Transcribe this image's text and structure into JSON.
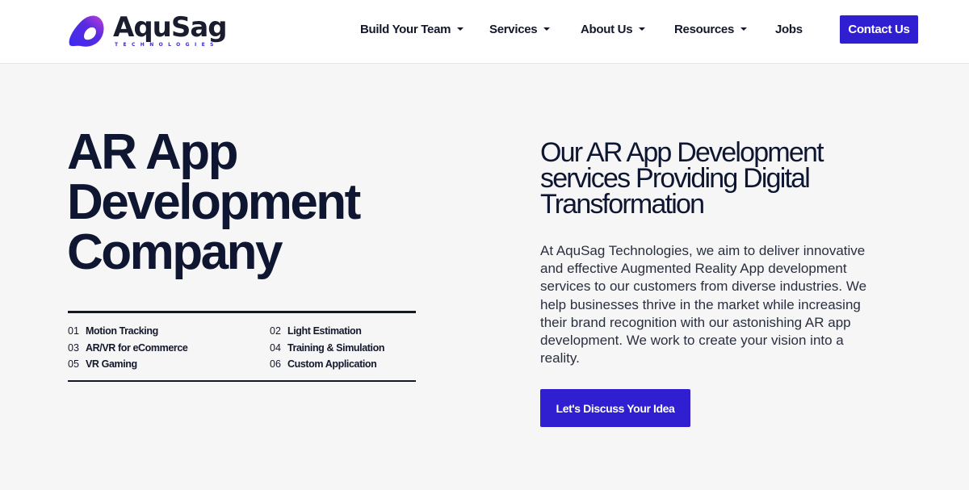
{
  "header": {
    "logo": {
      "name": "AquSag",
      "tagline": "TECHNOLOGIES"
    },
    "nav": [
      {
        "label": "Build Your Team",
        "has_dropdown": true
      },
      {
        "label": "Services",
        "has_dropdown": true
      },
      {
        "label": "About Us",
        "has_dropdown": true
      },
      {
        "label": "Resources",
        "has_dropdown": true
      },
      {
        "label": "Jobs",
        "has_dropdown": false
      }
    ],
    "contact_label": "Contact Us"
  },
  "hero": {
    "title_lines": [
      "AR App",
      "Development",
      "Company"
    ],
    "features": [
      {
        "num": "01",
        "label": "Motion Tracking"
      },
      {
        "num": "02",
        "label": "Light Estimation"
      },
      {
        "num": "03",
        "label": "AR/VR for eCommerce"
      },
      {
        "num": "04",
        "label": "Training & Simulation"
      },
      {
        "num": "05",
        "label": "VR Gaming"
      },
      {
        "num": "06",
        "label": "Custom Application"
      }
    ]
  },
  "right": {
    "heading_lines": [
      "Our AR App Development",
      "services Providing Digital",
      "Transformation"
    ],
    "paragraph": "At AquSag Technologies, we aim to deliver innovative and effective Augmented Reality App development services to our customers from diverse industries. We help businesses thrive in the market while increasing their brand recognition with our astonishing AR app development. We work to create your vision into a reality.",
    "cta_label": "Let's Discuss Your Idea"
  },
  "colors": {
    "brand": "#2f1fd1",
    "text_dark": "#0f1631",
    "background": "#f6f6f6",
    "header_bg": "#ffffff"
  }
}
